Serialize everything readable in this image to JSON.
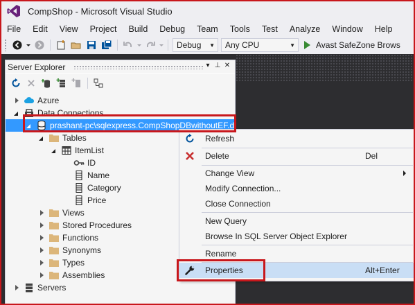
{
  "window": {
    "title": "CompShop - Microsoft Visual Studio"
  },
  "menu": [
    "File",
    "Edit",
    "View",
    "Project",
    "Build",
    "Debug",
    "Team",
    "Tools",
    "Test",
    "Analyze",
    "Window",
    "Help"
  ],
  "toolbar": {
    "config_value": "Debug",
    "platform_value": "Any CPU",
    "start_label": "Avast SafeZone Brows"
  },
  "server_explorer": {
    "title": "Server Explorer",
    "header_buttons": [
      "▾",
      "⊥",
      "✕"
    ],
    "tree": [
      {
        "label": "Azure"
      },
      {
        "label": "Data Connections"
      },
      {
        "label": "prashant-pc\\sqlexpress.CompShopDBwithoutEF.d"
      },
      {
        "label": "Tables"
      },
      {
        "label": "ItemList"
      },
      {
        "label": "ID"
      },
      {
        "label": "Name"
      },
      {
        "label": "Category"
      },
      {
        "label": "Price"
      },
      {
        "label": "Views"
      },
      {
        "label": "Stored Procedures"
      },
      {
        "label": "Functions"
      },
      {
        "label": "Synonyms"
      },
      {
        "label": "Types"
      },
      {
        "label": "Assemblies"
      },
      {
        "label": "Servers"
      }
    ]
  },
  "context_menu": {
    "items": [
      {
        "label": "Refresh",
        "shortcut": ""
      },
      {
        "label": "Delete",
        "shortcut": "Del"
      },
      {
        "label": "Change View",
        "shortcut": ""
      },
      {
        "label": "Modify Connection...",
        "shortcut": ""
      },
      {
        "label": "Close Connection",
        "shortcut": ""
      },
      {
        "label": "New Query",
        "shortcut": ""
      },
      {
        "label": "Browse In SQL Server Object Explorer",
        "shortcut": ""
      },
      {
        "label": "Rename",
        "shortcut": ""
      },
      {
        "label": "Properties",
        "shortcut": "Alt+Enter"
      }
    ]
  },
  "colors": {
    "accent_blue": "#3399ff",
    "annotation_red": "#c8171c",
    "chrome_bg": "#eeeef2",
    "editor_dark": "#2d2d30"
  }
}
